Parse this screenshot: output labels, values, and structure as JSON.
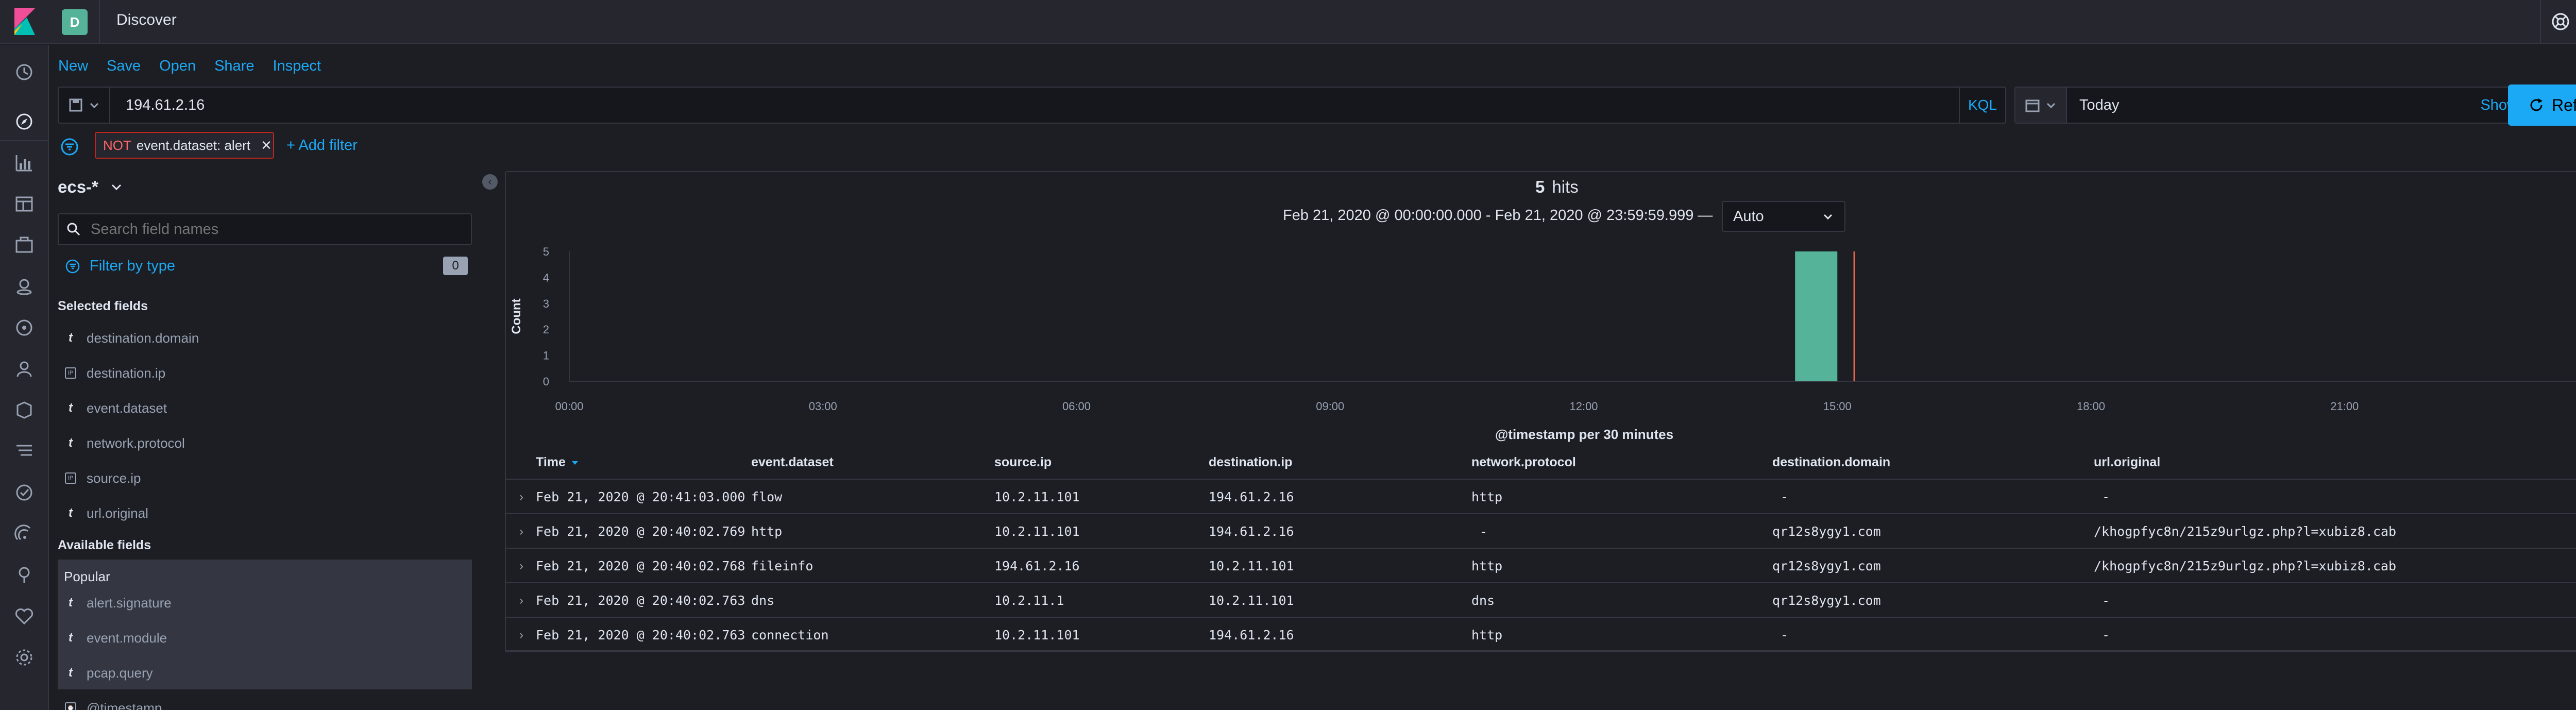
{
  "header": {
    "space_initial": "D",
    "title": "Discover"
  },
  "menu": {
    "new": "New",
    "save": "Save",
    "open": "Open",
    "share": "Share",
    "inspect": "Inspect"
  },
  "query": {
    "value": "194.61.2.16",
    "language": "KQL"
  },
  "date": {
    "value": "Today",
    "show_dates": "Show dates"
  },
  "refresh": {
    "label": "Refresh"
  },
  "filters": [
    {
      "prefix": "NOT",
      "text": "event.dataset: alert"
    }
  ],
  "add_filter": "+ Add filter",
  "sidebar": {
    "index_pattern": "ecs-*",
    "search_placeholder": "Search field names",
    "filter_by_type": "Filter by type",
    "filter_count": "0",
    "selected_heading": "Selected fields",
    "selected_fields": [
      {
        "type": "t",
        "name": "destination.domain"
      },
      {
        "type": "ip",
        "name": "destination.ip"
      },
      {
        "type": "t",
        "name": "event.dataset"
      },
      {
        "type": "t",
        "name": "network.protocol"
      },
      {
        "type": "ip",
        "name": "source.ip"
      },
      {
        "type": "t",
        "name": "url.original"
      }
    ],
    "available_heading": "Available fields",
    "popular_label": "Popular",
    "popular_fields": [
      {
        "type": "t",
        "name": "alert.signature"
      },
      {
        "type": "t",
        "name": "event.module"
      },
      {
        "type": "t",
        "name": "pcap.query"
      }
    ],
    "last_field": "@timestamp"
  },
  "results": {
    "hits_count": "5",
    "hits_label": "hits",
    "time_range": "Feb 21, 2020 @ 00:00:00.000 - Feb 21, 2020 @ 23:59:59.999 —",
    "interval": "Auto"
  },
  "chart_data": {
    "type": "bar",
    "ylabel": "Count",
    "xlabel": "@timestamp per 30 minutes",
    "yticks": [
      "0",
      "1",
      "2",
      "3",
      "4",
      "5"
    ],
    "ylim": [
      0,
      5
    ],
    "xticks": [
      "00:00",
      "03:00",
      "06:00",
      "09:00",
      "12:00",
      "15:00",
      "18:00",
      "21:00"
    ],
    "x_range_hours": [
      0,
      24
    ],
    "bars": [
      {
        "start_hour": 14.5,
        "end_hour": 15.0,
        "value": 5
      }
    ],
    "now_marker_hour": 15.2,
    "bar_color": "#54b399",
    "marker_color": "#e7664c"
  },
  "table": {
    "columns": [
      "Time",
      "event.dataset",
      "source.ip",
      "destination.ip",
      "network.protocol",
      "destination.domain",
      "url.original"
    ],
    "rows": [
      [
        "Feb 21, 2020 @ 20:41:03.000",
        "flow",
        "10.2.11.101",
        "194.61.2.16",
        "http",
        "-",
        "-"
      ],
      [
        "Feb 21, 2020 @ 20:40:02.769",
        "http",
        "10.2.11.101",
        "194.61.2.16",
        "-",
        "qr12s8ygy1.com",
        "/khogpfyc8n/215z9urlgz.php?l=xubiz8.cab"
      ],
      [
        "Feb 21, 2020 @ 20:40:02.768",
        "fileinfo",
        "194.61.2.16",
        "10.2.11.101",
        "http",
        "qr12s8ygy1.com",
        "/khogpfyc8n/215z9urlgz.php?l=xubiz8.cab"
      ],
      [
        "Feb 21, 2020 @ 20:40:02.763",
        "dns",
        "10.2.11.1",
        "10.2.11.101",
        "dns",
        "qr12s8ygy1.com",
        "-"
      ],
      [
        "Feb 21, 2020 @ 20:40:02.763",
        "connection",
        "10.2.11.101",
        "194.61.2.16",
        "http",
        "-",
        "-"
      ]
    ]
  },
  "colors": {
    "accent": "#1ba9f5",
    "background": "#1d1e24",
    "panel": "#25262e",
    "danger": "#bd271e"
  }
}
